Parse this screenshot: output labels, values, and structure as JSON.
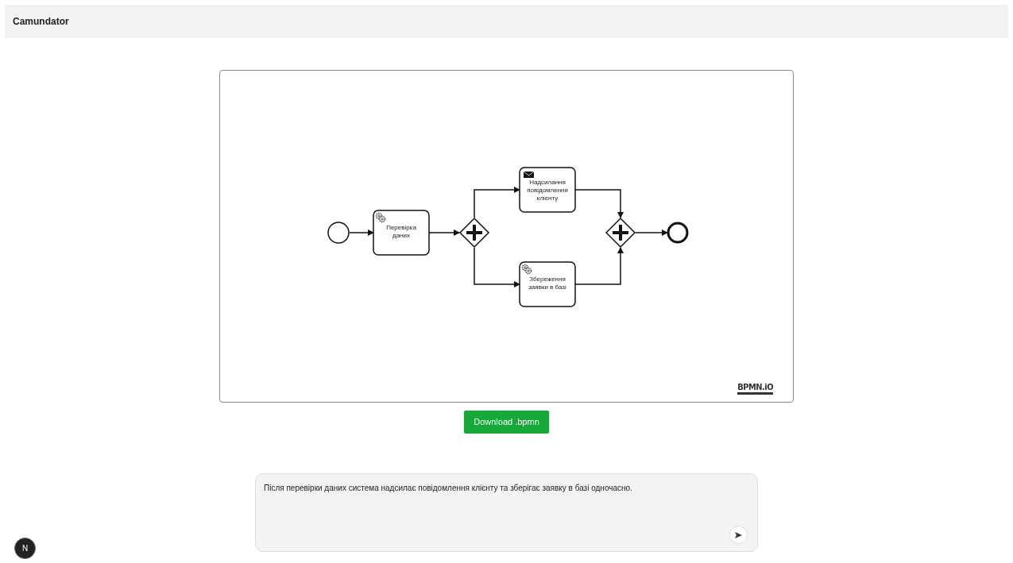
{
  "header": {
    "title": "Camundator"
  },
  "diagram": {
    "nodes": [
      {
        "kind": "start_event"
      },
      {
        "kind": "service_task",
        "label": "Перевірка даних"
      },
      {
        "kind": "parallel_gateway"
      },
      {
        "kind": "send_task",
        "label": "Надсилання повідомлення клієнту"
      },
      {
        "kind": "service_task",
        "label": "Збереження заявки в базі"
      },
      {
        "kind": "parallel_gateway"
      },
      {
        "kind": "end_event"
      }
    ],
    "watermark": "BPMN.iO"
  },
  "download_button": "Download .bpmn",
  "prompt": {
    "value": "Після перевірки даних система надсилає повідомлення клієнту та зберігає заявку в базі одночасно."
  },
  "dev_badge": "N"
}
